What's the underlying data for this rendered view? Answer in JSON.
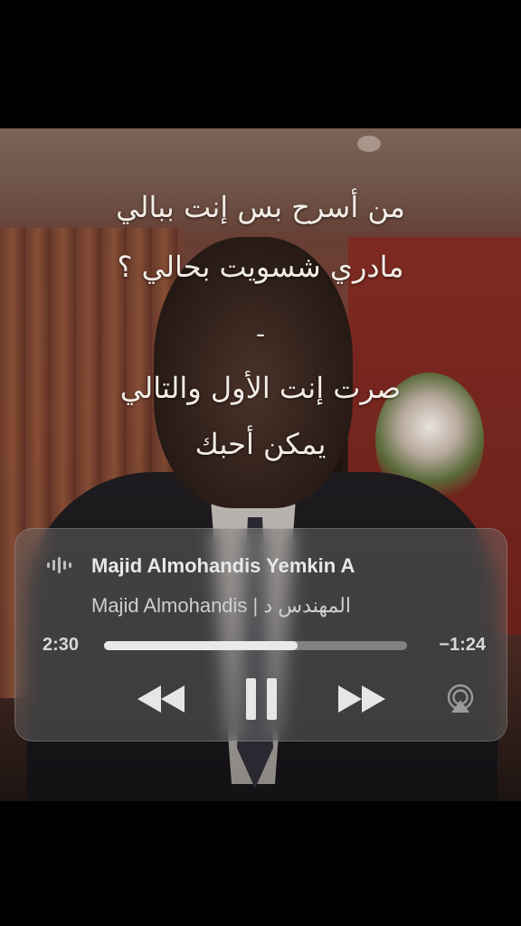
{
  "lyrics": {
    "line1": "من أسرح بس إنت ببالي",
    "line2": "مادري شسويت بحالي ؟",
    "line3": "صرت إنت الأول والتالي",
    "line4": "يمكن أحبك"
  },
  "player": {
    "title": "Majid Almohandis Yemkin A",
    "artist": "Majid Almohandis | المهندس د",
    "elapsed": "2:30",
    "remaining": "−1:24",
    "progress_fraction": 0.64,
    "state": "playing"
  },
  "icons": {
    "waveform": "waveform-icon",
    "rewind": "rewind-icon",
    "pause": "pause-icon",
    "forward": "fast-forward-icon",
    "airplay": "airplay-icon"
  },
  "colors": {
    "accent": "#e9e9e9",
    "panel": "#7a7a7a"
  }
}
